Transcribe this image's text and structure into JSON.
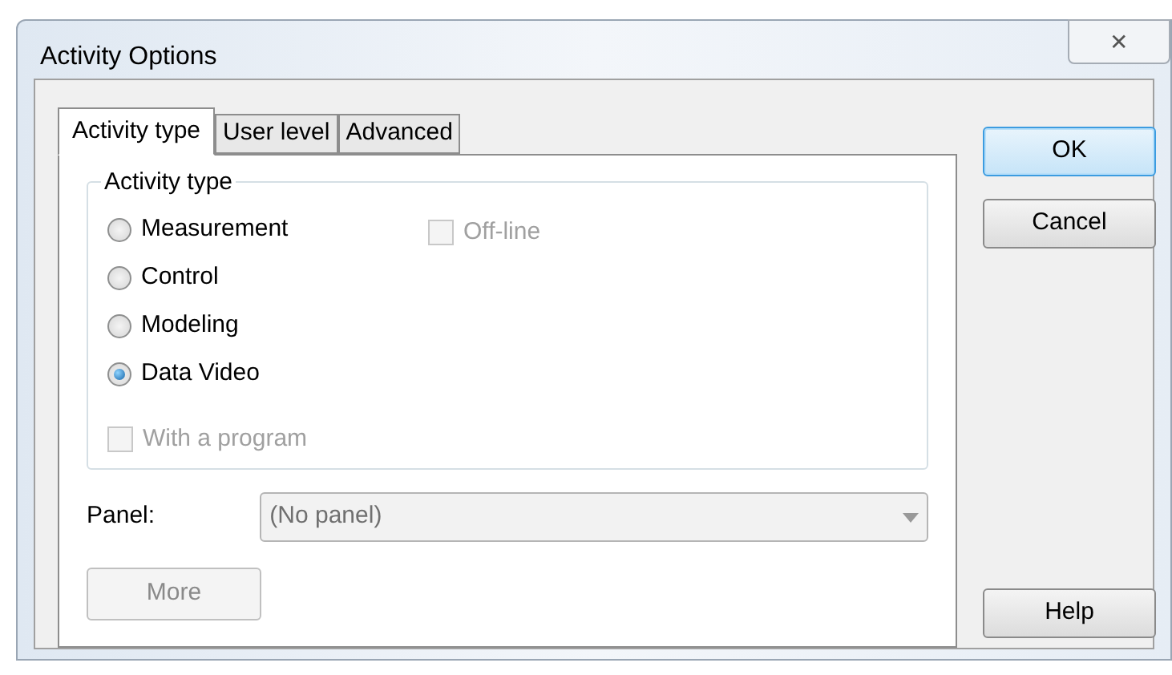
{
  "window": {
    "title": "Activity Options",
    "close": "✕"
  },
  "tabs": [
    {
      "label": "Activity type",
      "selected": true
    },
    {
      "label": "User level",
      "selected": false
    },
    {
      "label": "Advanced",
      "selected": false
    }
  ],
  "group": {
    "title": "Activity type",
    "options": [
      {
        "label": "Measurement",
        "selected": false
      },
      {
        "label": "Control",
        "selected": false
      },
      {
        "label": "Modeling",
        "selected": false
      },
      {
        "label": "Data Video",
        "selected": true
      }
    ],
    "offline": {
      "label": "Off-line",
      "checked": false,
      "disabled": true
    },
    "with_program": {
      "label": "With a program",
      "checked": false,
      "disabled": true
    }
  },
  "panel": {
    "label": "Panel:",
    "value": "(No panel)",
    "disabled": true
  },
  "more_button": {
    "label": "More",
    "disabled": true
  },
  "buttons": [
    {
      "label": "OK",
      "default": true
    },
    {
      "label": "Cancel",
      "default": false
    }
  ],
  "help_button": {
    "label": "Help"
  }
}
